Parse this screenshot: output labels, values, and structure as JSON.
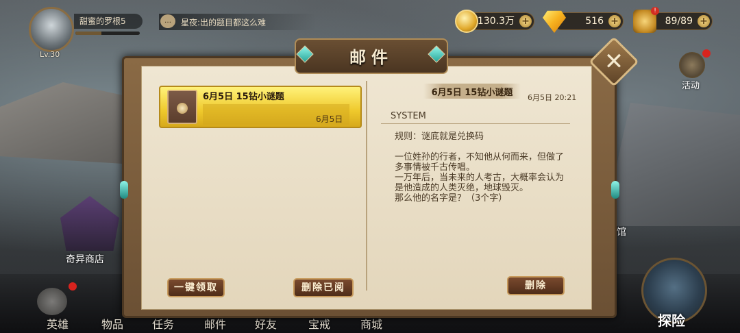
{
  "hud": {
    "player_name": "甜蜜的罗根5",
    "level": "Lv.30",
    "chat_message": "星夜:出的题目都这么难",
    "gold": "130.3万",
    "diamonds": "516",
    "stamina": "89/89"
  },
  "scene": {
    "activity_label": "活动",
    "shop_label": "奇异商店",
    "guan_label": "馆"
  },
  "nav": {
    "items": [
      "英雄",
      "物品",
      "任务",
      "邮件",
      "好友",
      "宝戒",
      "商城"
    ],
    "explore": "探险"
  },
  "mail": {
    "window_title": "邮件",
    "list": [
      {
        "title": "6月5日 15钻小谜题",
        "date": "6月5日"
      }
    ],
    "detail": {
      "title": "6月5日 15钻小谜题",
      "time": "6月5日 20:21",
      "sender": "SYSTEM",
      "rule": "规则：谜底就是兑换码",
      "body_lines": [
        "一位姓孙的行者，不知他从何而来，但做了",
        "多事情被千古传唱。",
        "一万年后，当未来的人考古，大概率会认为",
        "是他造成的人类灭绝，地球毁灭。",
        "那么他的名字是？（3个字）"
      ]
    },
    "buttons": {
      "claim_all": "一键领取",
      "delete_read": "删除已阅",
      "delete": "删除"
    }
  }
}
